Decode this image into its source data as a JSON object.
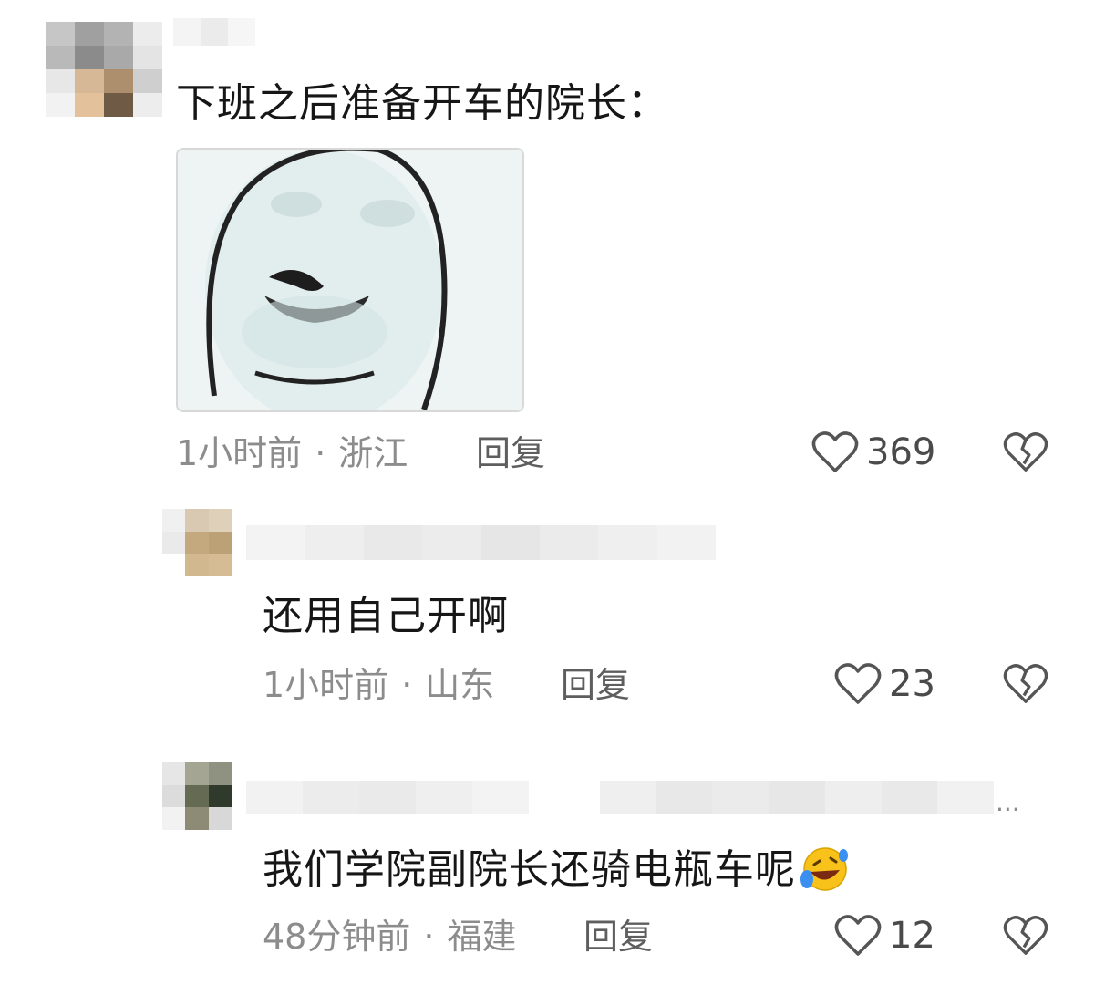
{
  "comments": [
    {
      "text": "下班之后准备开车的院长：",
      "time": "1小时前",
      "location": "浙江",
      "reply_label": "回复",
      "likes": "369"
    },
    {
      "text": "还用自己开啊",
      "time": "1小时前",
      "location": "山东",
      "reply_label": "回复",
      "likes": "23"
    },
    {
      "text": "我们学院副院长还骑电瓶车呢",
      "emoji": "🤣",
      "time": "48分钟前",
      "location": "福建",
      "reply_label": "回复",
      "likes": "12"
    }
  ],
  "separator": "·",
  "more_label": "...",
  "icons": {
    "like": "heart-outline-icon",
    "dislike": "broken-heart-icon"
  },
  "colors": {
    "text": "#161616",
    "meta": "#8c8c8c",
    "icon": "#555555"
  }
}
